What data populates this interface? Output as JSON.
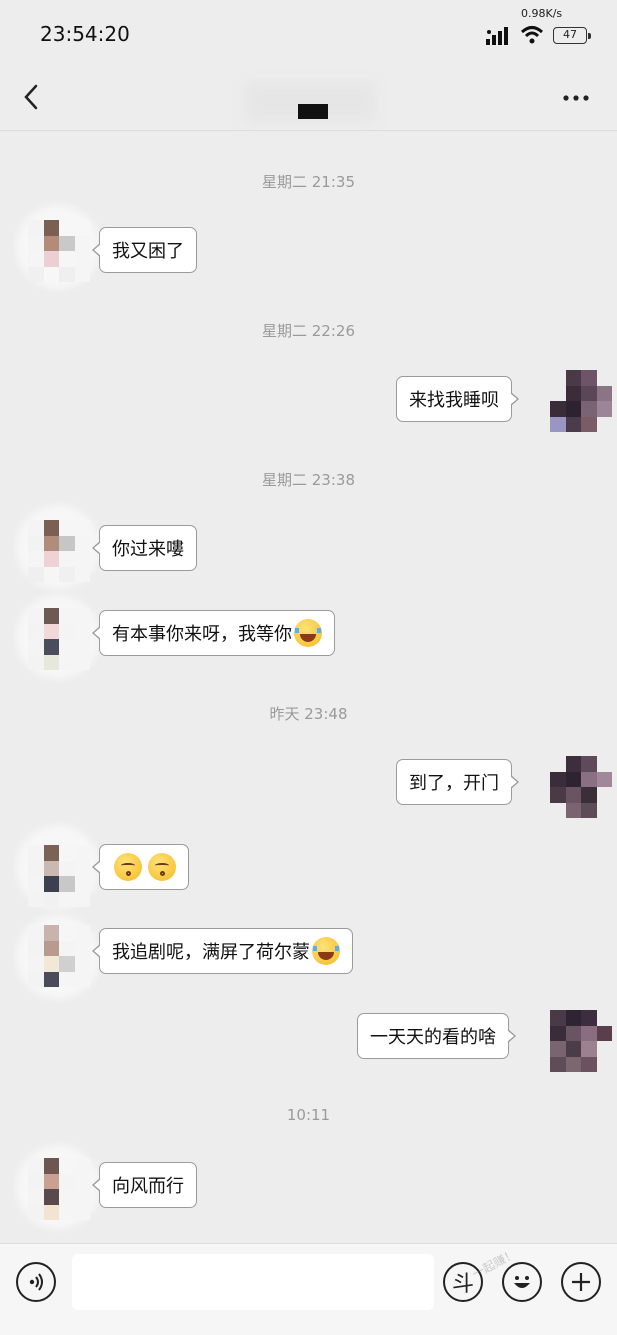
{
  "status_bar": {
    "time": "23:54:20",
    "net_speed": "0.98K/s",
    "battery": "47"
  },
  "nav": {
    "back_icon": "chevron-left-icon",
    "more_icon": "more-dots-icon"
  },
  "messages": [
    {
      "type": "time",
      "text": "星期二 21:35"
    },
    {
      "type": "msg",
      "side": "left",
      "text": "我又困了"
    },
    {
      "type": "time",
      "text": "星期二 22:26"
    },
    {
      "type": "msg",
      "side": "right",
      "text": "来找我睡呗"
    },
    {
      "type": "time",
      "text": "星期二 23:38"
    },
    {
      "type": "msg",
      "side": "left",
      "text": "你过来嘍"
    },
    {
      "type": "msg",
      "side": "left",
      "text": "有本事你来呀，我等你",
      "emoji": "laugh-cry"
    },
    {
      "type": "time",
      "text": "昨天 23:48"
    },
    {
      "type": "msg",
      "side": "right",
      "text": "到了，开门"
    },
    {
      "type": "msg",
      "side": "left",
      "text": "",
      "emoji": "kiss x2"
    },
    {
      "type": "msg",
      "side": "left",
      "text": "我追剧呢，满屏了荷尔蒙",
      "emoji": "laugh-cry"
    },
    {
      "type": "msg",
      "side": "right",
      "text": "一天天的看的啥"
    },
    {
      "type": "time",
      "text": "10:11"
    },
    {
      "type": "msg",
      "side": "left",
      "text": "向风而行"
    }
  ],
  "input_bar": {
    "voice_icon": "voice-icon",
    "input_value": "",
    "dou_label": "斗",
    "emoji_icon": "smiley-icon",
    "plus_icon": "plus-icon",
    "watermark": "一起赚！"
  },
  "colors": {
    "background": "#ededed",
    "bubble": "#ffffff",
    "bubble_border": "#9b9b9b",
    "timestamp": "#9a9a9a"
  }
}
